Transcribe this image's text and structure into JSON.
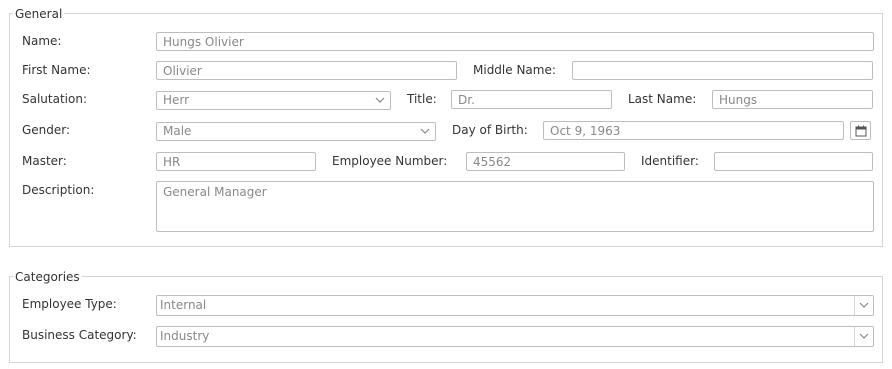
{
  "general": {
    "legend": "General",
    "name": {
      "label": "Name:",
      "value": "Hungs Olivier"
    },
    "first_name": {
      "label": "First Name:",
      "value": "Olivier"
    },
    "middle_name": {
      "label": "Middle Name:",
      "value": ""
    },
    "salutation": {
      "label": "Salutation:",
      "value": "Herr"
    },
    "title": {
      "label": "Title:",
      "value": "Dr."
    },
    "last_name": {
      "label": "Last Name:",
      "value": "Hungs"
    },
    "gender": {
      "label": "Gender:",
      "value": "Male"
    },
    "day_of_birth": {
      "label": "Day of Birth:",
      "value": "Oct 9, 1963"
    },
    "master": {
      "label": "Master:",
      "value": "HR"
    },
    "employee_number": {
      "label": "Employee Number:",
      "value": "45562"
    },
    "identifier": {
      "label": "Identifier:",
      "value": ""
    },
    "description": {
      "label": "Description:",
      "value": "General Manager"
    }
  },
  "categories": {
    "legend": "Categories",
    "employee_type": {
      "label": "Employee Type:",
      "value": "Internal"
    },
    "business_category": {
      "label": "Business Category:",
      "value": "Industry"
    }
  },
  "icons": {
    "dropdown": "chevron-down-icon",
    "date_picker": "calendar-icon"
  }
}
